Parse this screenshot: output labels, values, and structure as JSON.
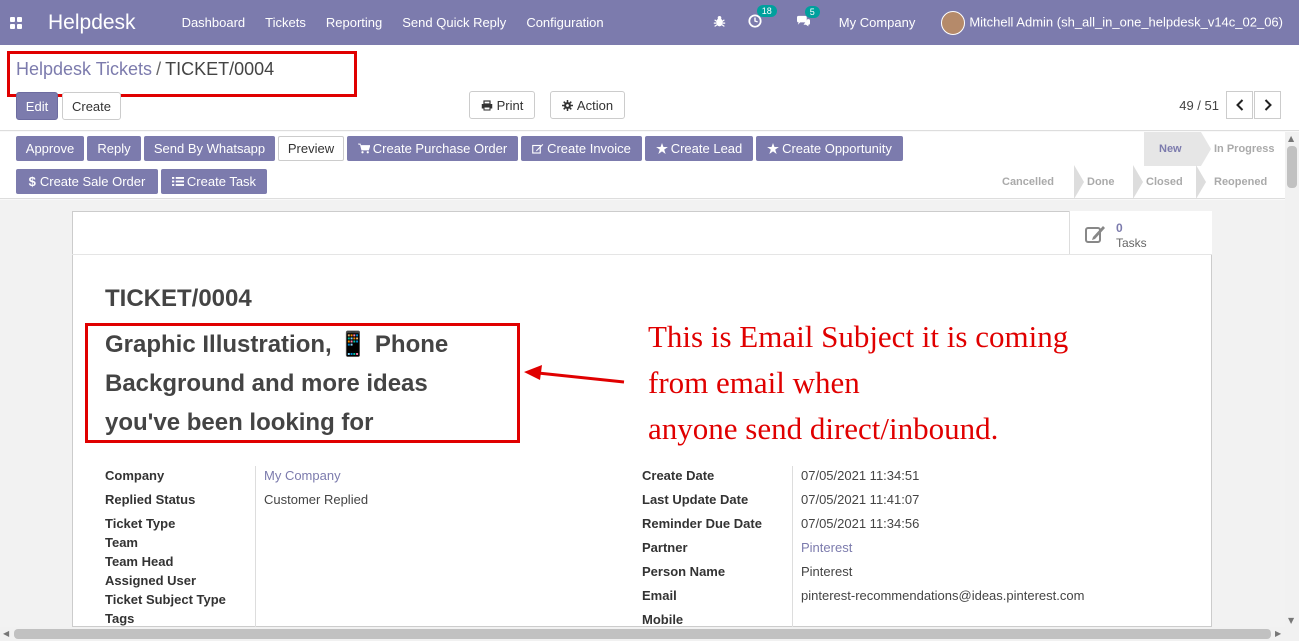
{
  "navbar": {
    "brand": "Helpdesk",
    "menu": [
      "Dashboard",
      "Tickets",
      "Reporting",
      "Send Quick Reply",
      "Configuration"
    ],
    "activities_count": "18",
    "messages_count": "5",
    "company": "My Company",
    "user": "Mitchell Admin (sh_all_in_one_helpdesk_v14c_02_06)"
  },
  "breadcrumb": {
    "parent": "Helpdesk Tickets",
    "separator": "/",
    "current": "TICKET/0004"
  },
  "toolbar": {
    "edit": "Edit",
    "create": "Create",
    "print": "Print",
    "action": "Action",
    "pager": "49 / 51"
  },
  "actions": {
    "approve": "Approve",
    "reply": "Reply",
    "whatsapp": "Send By Whatsapp",
    "preview": "Preview",
    "purchase_order": "Create Purchase Order",
    "invoice": "Create Invoice",
    "lead": "Create Lead",
    "opportunity": "Create Opportunity",
    "sale_order": "Create Sale Order",
    "task": "Create Task"
  },
  "stages": {
    "row1": [
      "New",
      "In Progress"
    ],
    "row2": [
      "Cancelled",
      "Done",
      "Closed",
      "Reopened"
    ],
    "active": "New"
  },
  "smart_button": {
    "count": "0",
    "label": "Tasks"
  },
  "ticket": {
    "name": "TICKET/0004",
    "subject_line1": "Graphic Illustration, 📱 Phone",
    "subject_line2": "Background and more ideas",
    "subject_line3": "you've been looking for"
  },
  "annotation": {
    "line1": "This is Email Subject it is coming",
    "line2": "from email when",
    "line3": "anyone send direct/inbound."
  },
  "fields_left": {
    "company_label": "Company",
    "company_value": "My Company",
    "replied_label": "Replied Status",
    "replied_value": "Customer Replied",
    "type_label": "Ticket Type",
    "team_label": "Team",
    "team_head_label": "Team Head",
    "assigned_label": "Assigned User",
    "subject_type_label": "Ticket Subject Type",
    "tags_label": "Tags"
  },
  "fields_right": {
    "create_date_label": "Create Date",
    "create_date_value": "07/05/2021 11:34:51",
    "update_label": "Last Update Date",
    "update_value": "07/05/2021 11:41:07",
    "reminder_label": "Reminder Due Date",
    "reminder_value": "07/05/2021 11:34:56",
    "partner_label": "Partner",
    "partner_value": "Pinterest",
    "person_label": "Person Name",
    "person_value": "Pinterest",
    "email_label": "Email",
    "email_value": "pinterest-recommendations@ideas.pinterest.com",
    "mobile_label": "Mobile"
  },
  "colors": {
    "brand": "#7c7bad",
    "annotation": "#e00000"
  }
}
